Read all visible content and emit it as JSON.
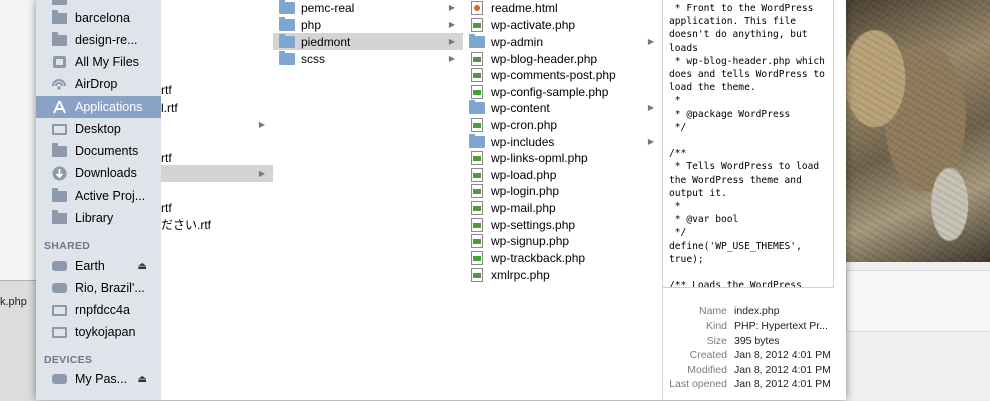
{
  "background": {
    "file_label": "k.php"
  },
  "sidebar": {
    "items": [
      {
        "label": "barcelona",
        "icon": "folder-icon"
      },
      {
        "label": "design-re...",
        "icon": "folder-icon"
      },
      {
        "label": "All My Files",
        "icon": "all-files-icon"
      },
      {
        "label": "AirDrop",
        "icon": "airdrop-icon"
      },
      {
        "label": "Applications",
        "icon": "applications-icon",
        "selected": true
      },
      {
        "label": "Desktop",
        "icon": "desktop-icon"
      },
      {
        "label": "Documents",
        "icon": "documents-icon"
      },
      {
        "label": "Downloads",
        "icon": "downloads-icon"
      },
      {
        "label": "Active Proj...",
        "icon": "folder-icon"
      },
      {
        "label": "Library",
        "icon": "folder-icon"
      }
    ],
    "shared_header": "SHARED",
    "shared": [
      {
        "label": "Earth",
        "icon": "drive-icon",
        "eject": true
      },
      {
        "label": "Rio, Brazil'...",
        "icon": "drive-icon"
      },
      {
        "label": "rnpfdcc4a",
        "icon": "computer-icon"
      },
      {
        "label": "toykojapan",
        "icon": "computer-icon"
      }
    ],
    "devices_header": "DEVICES",
    "devices": [
      {
        "label": "My Pas...",
        "icon": "drive-icon",
        "eject": true
      }
    ],
    "eject_glyph": "⏏"
  },
  "column1": {
    "rows": [
      "rtf",
      "l.rtf",
      "",
      "rtf",
      "",
      "rtf",
      "ださい.rtf"
    ]
  },
  "column2": {
    "rows": [
      {
        "label": "pemc-real",
        "folder": true
      },
      {
        "label": "php",
        "folder": true
      },
      {
        "label": "piedmont",
        "folder": true,
        "selected": true
      },
      {
        "label": "scss",
        "folder": true
      }
    ]
  },
  "column3": {
    "rows": [
      {
        "label": "readme.html",
        "kind": "html"
      },
      {
        "label": "wp-activate.php",
        "kind": "php"
      },
      {
        "label": "wp-admin",
        "kind": "folder"
      },
      {
        "label": "wp-blog-header.php",
        "kind": "php"
      },
      {
        "label": "wp-comments-post.php",
        "kind": "php"
      },
      {
        "label": "wp-config-sample.php",
        "kind": "php"
      },
      {
        "label": "wp-content",
        "kind": "folder"
      },
      {
        "label": "wp-cron.php",
        "kind": "php"
      },
      {
        "label": "wp-includes",
        "kind": "folder"
      },
      {
        "label": "wp-links-opml.php",
        "kind": "php"
      },
      {
        "label": "wp-load.php",
        "kind": "php"
      },
      {
        "label": "wp-login.php",
        "kind": "php"
      },
      {
        "label": "wp-mail.php",
        "kind": "php"
      },
      {
        "label": "wp-settings.php",
        "kind": "php"
      },
      {
        "label": "wp-signup.php",
        "kind": "php"
      },
      {
        "label": "wp-trackback.php",
        "kind": "php"
      },
      {
        "label": "xmlrpc.php",
        "kind": "php"
      }
    ]
  },
  "preview": {
    "code": " * Front to the WordPress\napplication. This file\ndoesn't do anything, but\nloads\n * wp-blog-header.php which\ndoes and tells WordPress to\nload the theme.\n *\n * @package WordPress\n */\n\n/**\n * Tells WordPress to load\nthe WordPress theme and\noutput it.\n *\n * @var bool\n */\ndefine('WP_USE_THEMES',\ntrue);\n\n/** Loads the WordPress",
    "info": [
      {
        "key": "Name",
        "value": "index.php"
      },
      {
        "key": "Kind",
        "value": "PHP: Hypertext Pr..."
      },
      {
        "key": "Size",
        "value": "395 bytes"
      },
      {
        "key": "Created",
        "value": "Jan 8, 2012 4:01 PM"
      },
      {
        "key": "Modified",
        "value": "Jan 8, 2012 4:01 PM"
      },
      {
        "key": "Last opened",
        "value": "Jan 8, 2012 4:01 PM"
      }
    ]
  },
  "colors": {
    "sidebar_bg": "#dfe4ea",
    "selection": "#8aa2c6",
    "column_selection": "#d4d4d4"
  }
}
